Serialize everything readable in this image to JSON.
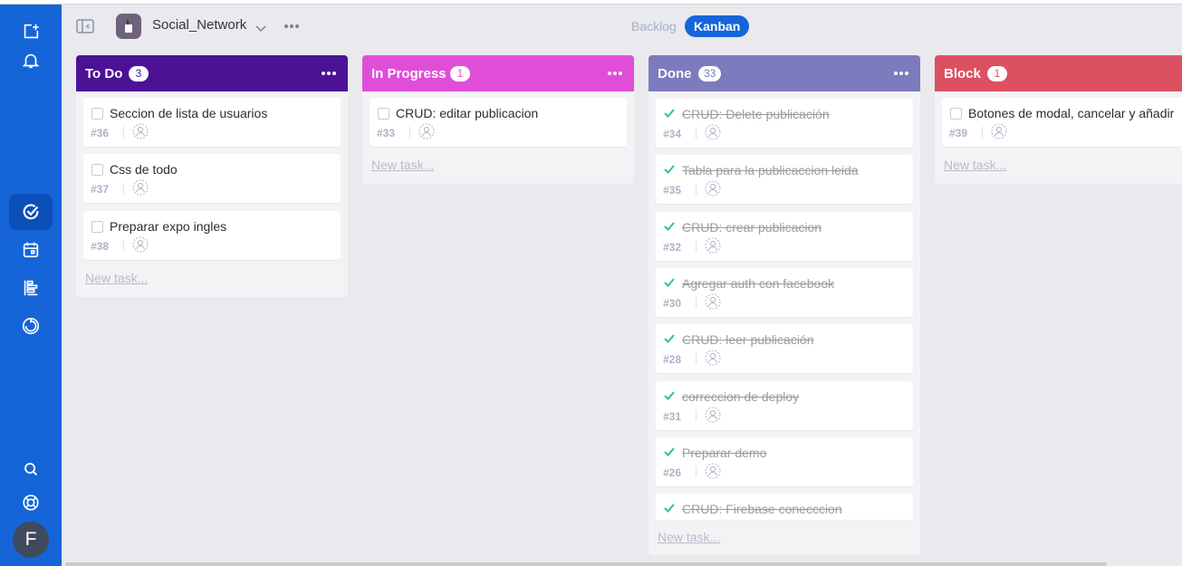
{
  "header": {
    "project_name": "Social_Network",
    "views": {
      "backlog": "Backlog",
      "kanban": "Kanban"
    }
  },
  "sidebar": {
    "top_icons": [
      "add-project-icon",
      "bell-icon"
    ],
    "nav_icons": [
      "tasks-icon",
      "calendar-icon",
      "timeline-icon",
      "reports-icon"
    ],
    "bottom_icons": [
      "search-icon",
      "help-icon"
    ],
    "avatar_letter": "F"
  },
  "columns": {
    "todo": {
      "title": "To Do",
      "count": "3",
      "color": "#4b1296",
      "new_task": "New task...",
      "cards": [
        {
          "title": "Seccion de lista de usuarios",
          "num": "#36"
        },
        {
          "title": "Css de todo",
          "num": "#37"
        },
        {
          "title": "Preparar expo ingles",
          "num": "#38"
        }
      ]
    },
    "progress": {
      "title": "In Progress",
      "count": "1",
      "color": "#e04ed8",
      "new_task": "New task...",
      "cards": [
        {
          "title": "CRUD: editar publicacion",
          "num": "#33"
        }
      ]
    },
    "done": {
      "title": "Done",
      "count": "33",
      "color": "#7c7bbd",
      "new_task": "New task...",
      "cards": [
        {
          "title": "CRUD: Delete publicación",
          "num": "#34"
        },
        {
          "title": "Tabla para la publicaccion leida",
          "num": "#35"
        },
        {
          "title": "CRUD: crear publicacion",
          "num": "#32"
        },
        {
          "title": "Agregar auth con facebook",
          "num": "#30"
        },
        {
          "title": "CRUD: leer publicación",
          "num": "#28"
        },
        {
          "title": "correccion de deploy",
          "num": "#31"
        },
        {
          "title": "Preparar demo",
          "num": "#26"
        },
        {
          "title": "CRUD: Firebase conecccion",
          "num": ""
        }
      ]
    },
    "block": {
      "title": "Block",
      "count": "1",
      "color": "#dd5061",
      "new_task": "New task...",
      "cards": [
        {
          "title": "Botones de modal, cancelar y añadir",
          "num": "#39"
        }
      ]
    }
  }
}
